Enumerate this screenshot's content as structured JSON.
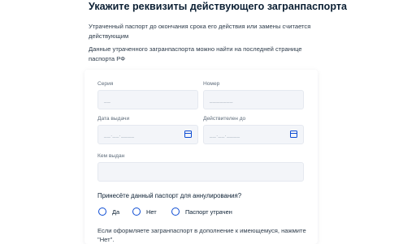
{
  "page": {
    "title": "Укажите реквизиты действующего загранпаспорта",
    "paragraph_1": "Утраченный паспорт до окончания срока его действия или замены считается действующим",
    "paragraph_2": "Данные утраченного загранпаспорта можно найти на последней странице паспорта РФ"
  },
  "form": {
    "series": {
      "label": "Серия",
      "placeholder": "__"
    },
    "number": {
      "label": "Номер",
      "placeholder": "_______"
    },
    "issue_date": {
      "label": "Дата выдачи",
      "placeholder": "__.__.____"
    },
    "valid_until": {
      "label": "Действителен до",
      "placeholder": "__.__.____"
    },
    "issued_by": {
      "label": "Кем выдан",
      "value": ""
    },
    "question": "Принесёте данный паспорт для аннулирования?",
    "options": [
      {
        "label": "Да",
        "selected": false
      },
      {
        "label": "Нет",
        "selected": false
      },
      {
        "label": "Паспорт утрачен",
        "selected": false
      }
    ],
    "note": "Если оформляете загранпаспорт в дополнение к имеющемуся, нажмите \"Нет\"."
  },
  "colors": {
    "accent": "#0d4cd3",
    "field_bg": "#f3f5f9",
    "text": "#0b1f33",
    "muted_label": "#5d6b7a"
  }
}
